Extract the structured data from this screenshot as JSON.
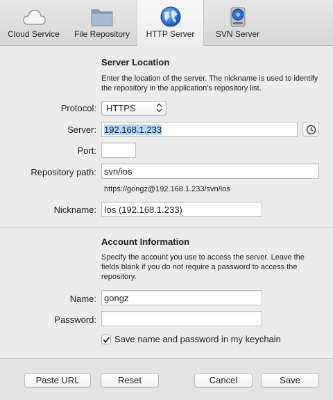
{
  "toolbar": {
    "tabs": [
      {
        "label": "Cloud Service",
        "icon": "cloud-icon"
      },
      {
        "label": "File Repository",
        "icon": "folder-icon"
      },
      {
        "label": "HTTP Server",
        "icon": "globe-icon",
        "active": true
      },
      {
        "label": "SVN Server",
        "icon": "server-drive-icon"
      }
    ]
  },
  "server_location": {
    "title": "Server Location",
    "description": "Enter the location of the server. The nickname is used to identify the repository in the application's repository list.",
    "protocol_label": "Protocol:",
    "protocol_value": "HTTPS",
    "server_label": "Server:",
    "server_value": "192.168.1.233",
    "port_label": "Port:",
    "port_value": "",
    "repo_path_label": "Repository path:",
    "repo_path_value": "svn/ios",
    "url_preview": "https://gongz@192.168.1.233/svn/ios",
    "nickname_label": "Nickname:",
    "nickname_value": "Ios (192.168.1.233)"
  },
  "account_info": {
    "title": "Account Information",
    "description": "Specify the account you use to access the server. Leave the fields blank if you do not require a password to access the repository.",
    "name_label": "Name:",
    "name_value": "gongz",
    "password_label": "Password:",
    "password_value": "",
    "keychain_label": "Save name and password in my keychain",
    "keychain_checked": true
  },
  "footer": {
    "paste_url": "Paste URL",
    "reset": "Reset",
    "cancel": "Cancel",
    "save": "Save"
  },
  "colors": {
    "selection": "#b3d7ff",
    "globe_blue": "#1f6fd1"
  }
}
